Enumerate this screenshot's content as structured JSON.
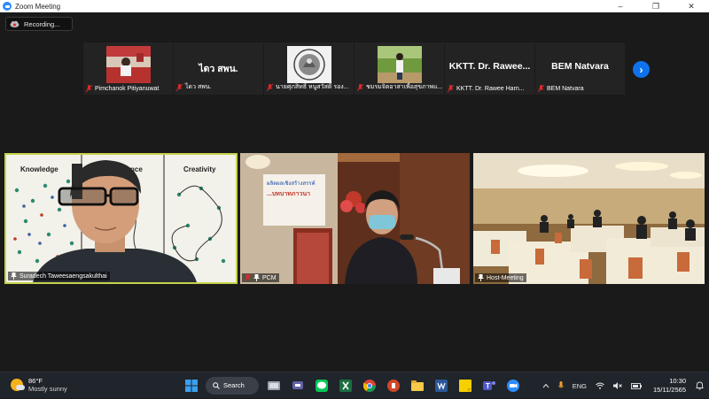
{
  "window": {
    "title": "Zoom Meeting",
    "minimize": "–",
    "restore": "❐",
    "close": "✕"
  },
  "recording": {
    "label": "Recording..."
  },
  "gallery": [
    {
      "name": "Pimchanok Pitiyanuwat",
      "display": "",
      "thumb": "photo"
    },
    {
      "name": "ไดว สพน.",
      "display": "ไดว สพน.",
      "thumb": "text"
    },
    {
      "name": "นายศุภสิทธิ์ หนูสวัสดิ์ รอง...",
      "display": "",
      "thumb": "emblem"
    },
    {
      "name": "ชมรมจิตอาสาเพื่อสุขภาพแ...",
      "display": "",
      "thumb": "photo"
    },
    {
      "name": "KKTT. Dr. Rawee Harn...",
      "display": "KKTT. Dr. Rawee...",
      "thumb": "text"
    },
    {
      "name": "BEM Natvara",
      "display": "BEM Natvara",
      "thumb": "text"
    }
  ],
  "next_arrow": "›",
  "videos": [
    {
      "name": "Suradech Taweesaengsakulthai",
      "slide_words": [
        "Knowledge",
        "nce",
        "Creativity"
      ]
    },
    {
      "name": "PCM",
      "banner": "ผลิตผลเชิงสร้างสรรค์",
      "banner2": "...บทบาทภาวนา"
    },
    {
      "name": "Host-Meeting"
    }
  ],
  "taskbar": {
    "weather_temp": "86°F",
    "weather_cond": "Mostly sunny",
    "search_label": "Search",
    "lang": "ENG",
    "time": "10:30",
    "date": "15/11/2565"
  },
  "colors": {
    "accent": "#2d8cff",
    "active_speaker": "#c7d34b",
    "mute": "#e02828"
  }
}
